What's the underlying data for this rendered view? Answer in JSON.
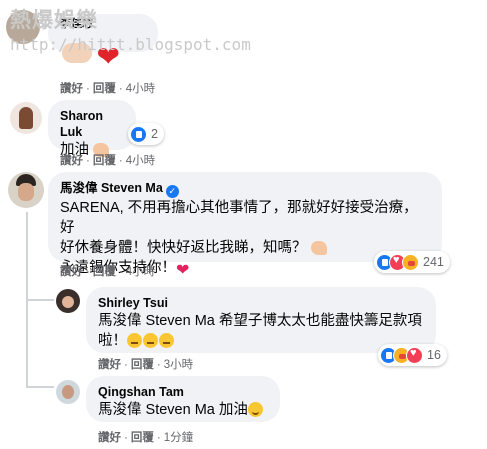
{
  "watermark": {
    "line1": "熱爆娛樂",
    "line2": "http://hittt.blogspot.com"
  },
  "actions": {
    "like": "讚好",
    "reply": "回覆",
    "separator": "·"
  },
  "top_comment": {
    "author": "李佳芯",
    "time": "4小時",
    "emojis": [
      "muscle-emoji",
      "heart-emoji"
    ]
  },
  "comments": [
    {
      "author": "Sharon Luk",
      "text": "加油",
      "time": "4小時",
      "reaction_count": "2",
      "reactions": [
        "like"
      ]
    },
    {
      "author": "馬浚偉 Steven Ma",
      "verified": true,
      "line1": "SARENA, 不用再擔心其他事情了，那就好好接受治療，好",
      "line2": "好休養身體！快快好返比我睇，知嗎？",
      "line3": "永遠錫你支持你！",
      "time": "4小時",
      "reaction_count": "241",
      "reactions": [
        "like",
        "love",
        "care"
      ]
    },
    {
      "author": "Shirley Tsui",
      "line1": "馬浚偉 Steven Ma 希望子博太太也能盡快籌足款項",
      "line2": "啦！",
      "time": "3小時",
      "reaction_count": "16",
      "reactions": [
        "like",
        "care",
        "love"
      ]
    },
    {
      "author": "Qingshan Tam",
      "text": "馬浚偉 Steven Ma 加油",
      "time": "1分鐘"
    }
  ],
  "colors": {
    "bubble": "#f0f2f5",
    "meta": "#65676b",
    "like": "#1877f2",
    "love": "#f33e58",
    "care": "#f7b125"
  }
}
